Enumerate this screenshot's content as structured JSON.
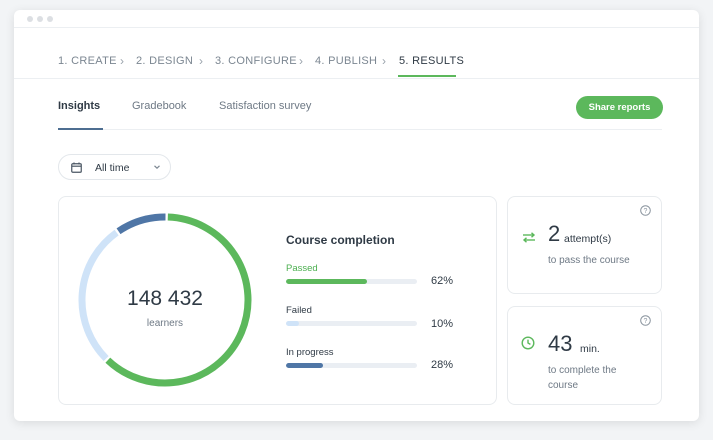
{
  "steps": [
    {
      "label": "1. CREATE"
    },
    {
      "label": "2. DESIGN"
    },
    {
      "label": "3. CONFIGURE"
    },
    {
      "label": "4. PUBLISH"
    },
    {
      "label": "5. RESULTS"
    }
  ],
  "step_separator": "›",
  "tabs": [
    {
      "label": "Insights"
    },
    {
      "label": "Gradebook"
    },
    {
      "label": "Satisfaction survey"
    }
  ],
  "share_button": "Share reports",
  "date_filter": {
    "value": "All time",
    "icon": "calendar-icon"
  },
  "learners": {
    "count": "148 432",
    "caption": "learners"
  },
  "donut": {
    "segments": [
      {
        "name": "Passed",
        "fraction": 0.62,
        "color": "#5cb85c"
      },
      {
        "name": "In progress",
        "fraction": 0.28,
        "color": "#cfe3f8"
      },
      {
        "name": "Failed",
        "fraction": 0.1,
        "color": "#4f76a6"
      }
    ]
  },
  "completion": {
    "title": "Course completion",
    "rows": [
      {
        "label": "Passed",
        "percent_text": "62%",
        "value": 0.62,
        "color": "#5cb85c",
        "label_color": "#4caf50"
      },
      {
        "label": "Failed",
        "percent_text": "10%",
        "value": 0.1,
        "color": "#cfe3f8",
        "label_color": "#2f3a45"
      },
      {
        "label": "In progress",
        "percent_text": "28%",
        "value": 0.28,
        "color": "#4f76a6",
        "label_color": "#2f3a45"
      }
    ]
  },
  "attempts": {
    "value": "2",
    "unit": "attempt(s)",
    "desc": "to pass the course",
    "icon": "swap-arrows-icon"
  },
  "time": {
    "value": "43",
    "unit": "min.",
    "desc": "to complete the course",
    "icon": "clock-icon"
  },
  "colors": {
    "accent": "#5cb85c",
    "tab_underline": "#4d6e91"
  }
}
